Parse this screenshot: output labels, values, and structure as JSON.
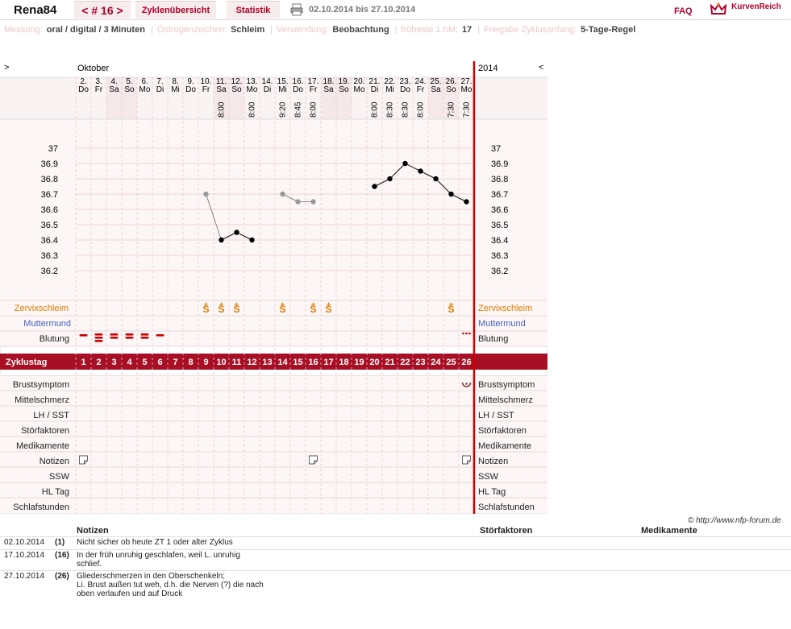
{
  "header": {
    "user": "Rena84",
    "cycle_label": "< # 16 >",
    "tab_overview": "Zyklenübersicht",
    "tab_stats": "Statistik",
    "date_range": "02.10.2014 bis 27.10.2014",
    "faq": "FAQ",
    "logo_text": "KurvenReich"
  },
  "info": {
    "measure_label": "Messung:",
    "measure_value": "oral / digital / 3 Minuten",
    "estrogen_label": "Östrogenzeichen:",
    "estrogen_value": "Schleim",
    "usage_label": "Verwendung:",
    "usage_value": "Beobachtung",
    "earliest_label": "früheste 1.hM:",
    "earliest_value": "17",
    "release_label": "Freigabe Zyklusanfang:",
    "release_value": "5-Tage-Regel"
  },
  "chart": {
    "month": "Oktober",
    "year": "2014",
    "nav_left": ">",
    "nav_right": "<",
    "days": [
      {
        "d": "2.",
        "w": "Do",
        "t": ""
      },
      {
        "d": "3.",
        "w": "Fr",
        "t": ""
      },
      {
        "d": "4.",
        "w": "Sa",
        "t": ""
      },
      {
        "d": "5.",
        "w": "So",
        "t": ""
      },
      {
        "d": "6.",
        "w": "Mo",
        "t": ""
      },
      {
        "d": "7.",
        "w": "Di",
        "t": ""
      },
      {
        "d": "8.",
        "w": "Mi",
        "t": ""
      },
      {
        "d": "9.",
        "w": "Do",
        "t": ""
      },
      {
        "d": "10.",
        "w": "Fr",
        "t": ""
      },
      {
        "d": "11.",
        "w": "Sa",
        "t": "8:00"
      },
      {
        "d": "12.",
        "w": "So",
        "t": ""
      },
      {
        "d": "13.",
        "w": "Mo",
        "t": "8:00"
      },
      {
        "d": "14.",
        "w": "Di",
        "t": ""
      },
      {
        "d": "15.",
        "w": "Mi",
        "t": "9:20"
      },
      {
        "d": "16.",
        "w": "Do",
        "t": "8:45"
      },
      {
        "d": "17.",
        "w": "Fr",
        "t": "8:00"
      },
      {
        "d": "18.",
        "w": "Sa",
        "t": ""
      },
      {
        "d": "19.",
        "w": "So",
        "t": ""
      },
      {
        "d": "20.",
        "w": "Mo",
        "t": ""
      },
      {
        "d": "21.",
        "w": "Di",
        "t": "8:00"
      },
      {
        "d": "22.",
        "w": "Mi",
        "t": "8:30"
      },
      {
        "d": "23.",
        "w": "Do",
        "t": "8:30"
      },
      {
        "d": "24.",
        "w": "Fr",
        "t": "8:00"
      },
      {
        "d": "25.",
        "w": "Sa",
        "t": ""
      },
      {
        "d": "26.",
        "w": "So",
        "t": "7:30"
      },
      {
        "d": "27.",
        "w": "Mo",
        "t": "7:30"
      }
    ],
    "weekend_idx": [
      2,
      3,
      9,
      10,
      16,
      17,
      23,
      24
    ],
    "y_ticks": [
      "37",
      "36.9",
      "36.8",
      "36.7",
      "36.6",
      "36.5",
      "36.4",
      "36.3",
      "36.2"
    ],
    "temps": [
      {
        "i": 8,
        "v": 36.7,
        "type": "gray"
      },
      {
        "i": 9,
        "v": 36.4,
        "type": "black"
      },
      {
        "i": 10,
        "v": 36.45,
        "type": "black"
      },
      {
        "i": 11,
        "v": 36.4,
        "type": "black"
      },
      {
        "i": 13,
        "v": 36.7,
        "type": "gray"
      },
      {
        "i": 14,
        "v": 36.65,
        "type": "gray"
      },
      {
        "i": 15,
        "v": 36.65,
        "type": "gray"
      },
      {
        "i": 19,
        "v": 36.75,
        "type": "black"
      },
      {
        "i": 20,
        "v": 36.8,
        "type": "black"
      },
      {
        "i": 21,
        "v": 36.9,
        "type": "black"
      },
      {
        "i": 22,
        "v": 36.85,
        "type": "black"
      },
      {
        "i": 23,
        "v": 36.8,
        "type": "black"
      },
      {
        "i": 24,
        "v": 36.7,
        "type": "black"
      },
      {
        "i": 25,
        "v": 36.65,
        "type": "black"
      }
    ],
    "lines": [
      [
        0,
        1
      ],
      [
        1,
        2
      ],
      [
        2,
        3
      ],
      [
        4,
        5
      ],
      [
        5,
        6
      ],
      [
        7,
        8
      ],
      [
        8,
        9
      ],
      [
        9,
        10
      ],
      [
        10,
        11
      ],
      [
        11,
        12
      ],
      [
        12,
        13
      ]
    ],
    "row_zervix": "Zervixschleim",
    "row_mutter": "Muttermund",
    "row_blutung": "Blutung",
    "row_zyklustag": "Zyklustag",
    "zervix_idx": [
      8,
      9,
      10,
      13,
      15,
      16,
      24
    ],
    "zervix_symbol": "S",
    "blutung": [
      {
        "i": 0,
        "n": 1
      },
      {
        "i": 1,
        "n": 3
      },
      {
        "i": 2,
        "n": 2
      },
      {
        "i": 3,
        "n": 2
      },
      {
        "i": 4,
        "n": 2
      },
      {
        "i": 5,
        "n": 1
      }
    ],
    "blutung_dots_idx": 25,
    "cycle_days": [
      "1",
      "2",
      "3",
      "4",
      "5",
      "6",
      "7",
      "8",
      "9",
      "10",
      "11",
      "12",
      "13",
      "14",
      "15",
      "16",
      "17",
      "18",
      "19",
      "20",
      "21",
      "22",
      "23",
      "24",
      "25",
      "26"
    ],
    "lower_rows": [
      "Brustsymptom",
      "Mittelschmerz",
      "LH / SST",
      "Störfaktoren",
      "Medikamente",
      "Notizen",
      "SSW",
      "HL Tag",
      "Schlafstunden"
    ],
    "breast_idx": 25,
    "note_idx": [
      0,
      15,
      25
    ]
  },
  "footer": {
    "copyright": "© http://www.nfp-forum.de",
    "h_notes": "Notizen",
    "h_stoer": "Störfaktoren",
    "h_medi": "Medikamente",
    "rows": [
      {
        "date": "02.10.2014",
        "day": "(1)",
        "lines": [
          "Nicht sicher ob heute ZT 1 oder alter Zyklus"
        ]
      },
      {
        "date": "17.10.2014",
        "day": "(16)",
        "lines": [
          "In der früh unruhig geschlafen, weil L. unruhig",
          "schlief."
        ]
      },
      {
        "date": "27.10.2014",
        "day": "(26)",
        "lines": [
          "Gliederschmerzen in den Oberschenkeln;",
          "Li. Brust außen tut weh, d.h. die Nerven (?) die nach",
          "oben verlaufen und auf Druck"
        ]
      }
    ]
  },
  "colors": {
    "accent": "#b0002a",
    "bar": "#a80f24",
    "grid": "#f2c6c6",
    "pink": "#f5e8ea",
    "orange": "#e07b00",
    "blue": "#4a5fc1",
    "red": "#cc0000"
  }
}
